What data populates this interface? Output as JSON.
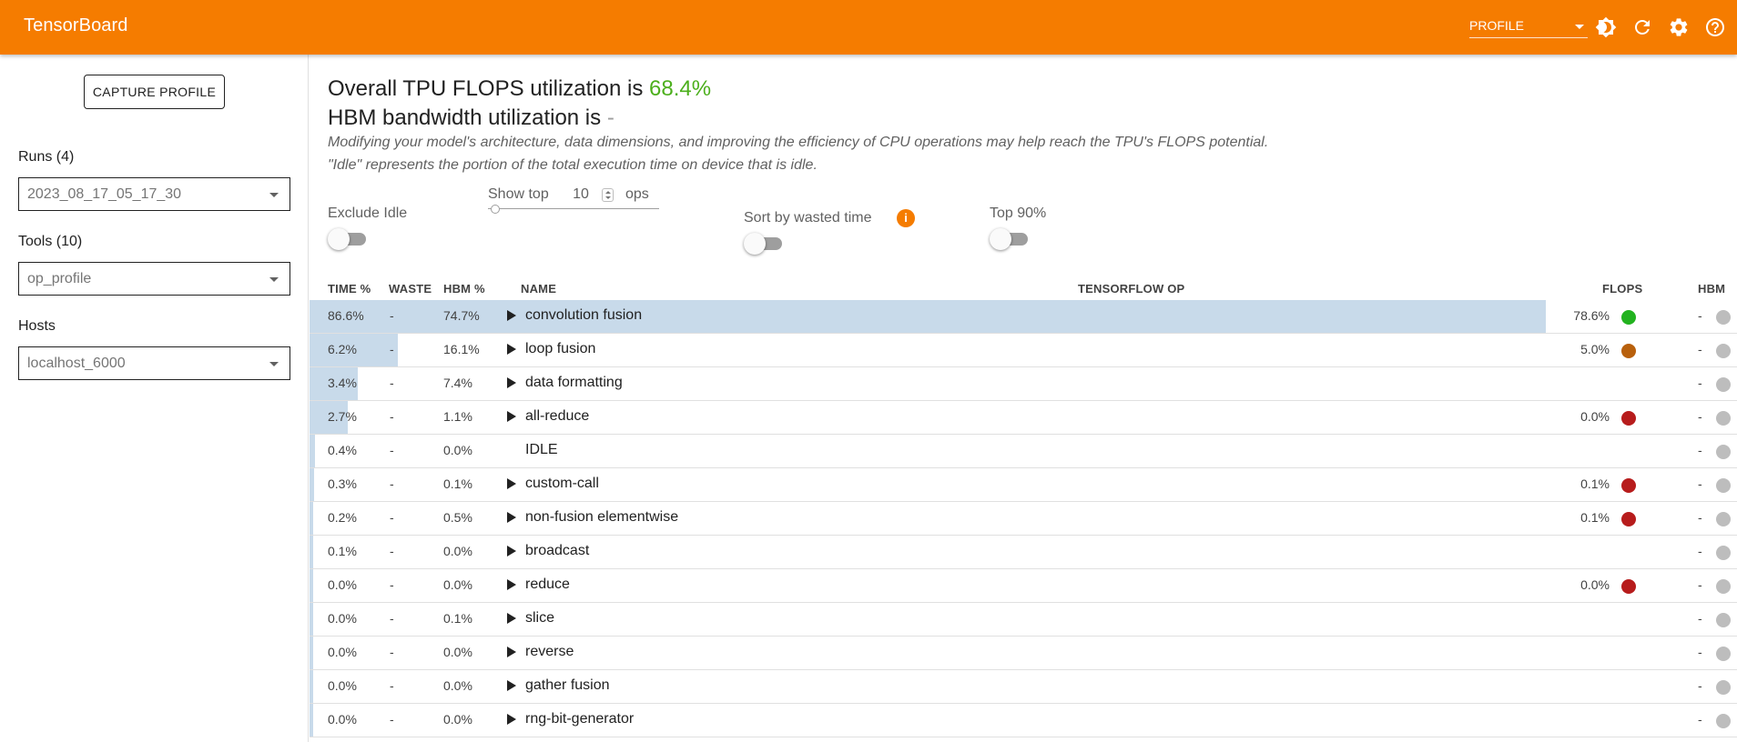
{
  "app": {
    "title": "TensorBoard",
    "plugin_select": "PROFILE",
    "brand_color": "#f57c00",
    "icons": [
      "theme-toggle-icon",
      "refresh-icon",
      "settings-icon",
      "help-icon"
    ]
  },
  "sidebar": {
    "capture_button": "CAPTURE PROFILE",
    "runs": {
      "label": "Runs (4)",
      "value": "2023_08_17_05_17_30"
    },
    "tools": {
      "label": "Tools (10)",
      "value": "op_profile"
    },
    "hosts": {
      "label": "Hosts",
      "value": "localhost_6000"
    }
  },
  "main": {
    "flops_prefix": "Overall TPU FLOPS utilization is ",
    "flops_value": "68.4%",
    "flops_color": "#4caf1c",
    "hbm_prefix": "HBM bandwidth utilization is ",
    "hbm_value": "-",
    "description_1": "Modifying your model's architecture, data dimensions, and improving the efficiency of CPU operations may help reach the TPU's FLOPS potential.",
    "description_2": "\"Idle\" represents the portion of the total execution time on device that is idle.",
    "controls": {
      "exclude_idle": {
        "label": "Exclude Idle",
        "on": false
      },
      "show_top": {
        "prefix": "Show top",
        "value": "10",
        "suffix": "ops"
      },
      "sort_by_waste": {
        "label": "Sort by wasted time",
        "info_glyph": "i",
        "on": false
      },
      "top_90": {
        "label": "Top 90%",
        "on": false
      }
    }
  },
  "table": {
    "headers": {
      "time": "TIME %",
      "waste": "WASTE",
      "hbm": "HBM %",
      "name": "NAME",
      "tf_op": "TENSORFLOW OP",
      "flops": "FLOPS",
      "hbm_util": "HBM"
    },
    "rows": [
      {
        "time": "86.6%",
        "time_fraction": 0.866,
        "waste": "-",
        "hbm": "74.7%",
        "name": "convolution fusion",
        "expandable": true,
        "flops": "78.6%",
        "flops_color": "#22b21f",
        "hbm_util": "-"
      },
      {
        "time": "6.2%",
        "time_fraction": 0.062,
        "waste": "-",
        "hbm": "16.1%",
        "name": "loop fusion",
        "expandable": true,
        "flops": "5.0%",
        "flops_color": "#b8600c",
        "hbm_util": "-"
      },
      {
        "time": "3.4%",
        "time_fraction": 0.034,
        "waste": "-",
        "hbm": "7.4%",
        "name": "data formatting",
        "expandable": true,
        "flops": "",
        "flops_color": "",
        "hbm_util": "-"
      },
      {
        "time": "2.7%",
        "time_fraction": 0.027,
        "waste": "-",
        "hbm": "1.1%",
        "name": "all-reduce",
        "expandable": true,
        "flops": "0.0%",
        "flops_color": "#b71c1c",
        "hbm_util": "-"
      },
      {
        "time": "0.4%",
        "time_fraction": 0.004,
        "waste": "-",
        "hbm": "0.0%",
        "name": "IDLE",
        "expandable": false,
        "flops": "",
        "flops_color": "",
        "hbm_util": "-"
      },
      {
        "time": "0.3%",
        "time_fraction": 0.003,
        "waste": "-",
        "hbm": "0.1%",
        "name": "custom-call",
        "expandable": true,
        "flops": "0.1%",
        "flops_color": "#b71c1c",
        "hbm_util": "-"
      },
      {
        "time": "0.2%",
        "time_fraction": 0.002,
        "waste": "-",
        "hbm": "0.5%",
        "name": "non-fusion elementwise",
        "expandable": true,
        "flops": "0.1%",
        "flops_color": "#b71c1c",
        "hbm_util": "-"
      },
      {
        "time": "0.1%",
        "time_fraction": 0.001,
        "waste": "-",
        "hbm": "0.0%",
        "name": "broadcast",
        "expandable": true,
        "flops": "",
        "flops_color": "",
        "hbm_util": "-"
      },
      {
        "time": "0.0%",
        "time_fraction": 0.0,
        "waste": "-",
        "hbm": "0.0%",
        "name": "reduce",
        "expandable": true,
        "flops": "0.0%",
        "flops_color": "#b71c1c",
        "hbm_util": "-"
      },
      {
        "time": "0.0%",
        "time_fraction": 0.0,
        "waste": "-",
        "hbm": "0.1%",
        "name": "slice",
        "expandable": true,
        "flops": "",
        "flops_color": "",
        "hbm_util": "-"
      },
      {
        "time": "0.0%",
        "time_fraction": 0.0,
        "waste": "-",
        "hbm": "0.0%",
        "name": "reverse",
        "expandable": true,
        "flops": "",
        "flops_color": "",
        "hbm_util": "-"
      },
      {
        "time": "0.0%",
        "time_fraction": 0.0,
        "waste": "-",
        "hbm": "0.0%",
        "name": "gather fusion",
        "expandable": true,
        "flops": "",
        "flops_color": "",
        "hbm_util": "-"
      },
      {
        "time": "0.0%",
        "time_fraction": 0.0,
        "waste": "-",
        "hbm": "0.0%",
        "name": "rng-bit-generator",
        "expandable": true,
        "flops": "",
        "flops_color": "",
        "hbm_util": "-"
      }
    ]
  }
}
